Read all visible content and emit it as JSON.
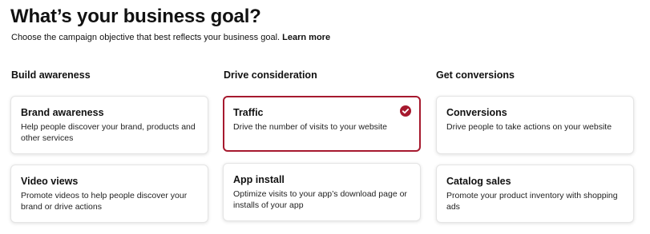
{
  "header": {
    "title": "What’s your business goal?",
    "subtitle": "Choose the campaign objective that best reflects your business goal.",
    "learn_more": "Learn more"
  },
  "columns": [
    {
      "heading": "Build awareness",
      "cards": [
        {
          "title": "Brand awareness",
          "description": "Help people discover your brand, products and other services",
          "selected": false
        },
        {
          "title": "Video views",
          "description": "Promote videos to help people discover your brand or drive actions",
          "selected": false
        }
      ]
    },
    {
      "heading": "Drive consideration",
      "cards": [
        {
          "title": "Traffic",
          "description": "Drive the number of visits to your website",
          "selected": true
        },
        {
          "title": "App install",
          "description": "Optimize visits to your app’s download page or installs of your app",
          "selected": false
        }
      ]
    },
    {
      "heading": "Get conversions",
      "cards": [
        {
          "title": "Conversions",
          "description": "Drive people to take actions on your website",
          "selected": false
        },
        {
          "title": "Catalog sales",
          "description": "Promote your product inventory with shopping ads",
          "selected": false
        }
      ]
    }
  ],
  "colors": {
    "accent": "#a6192e",
    "text": "#111111",
    "border": "#e4e4e4"
  },
  "icons": {
    "selected": "check-circle-icon"
  }
}
